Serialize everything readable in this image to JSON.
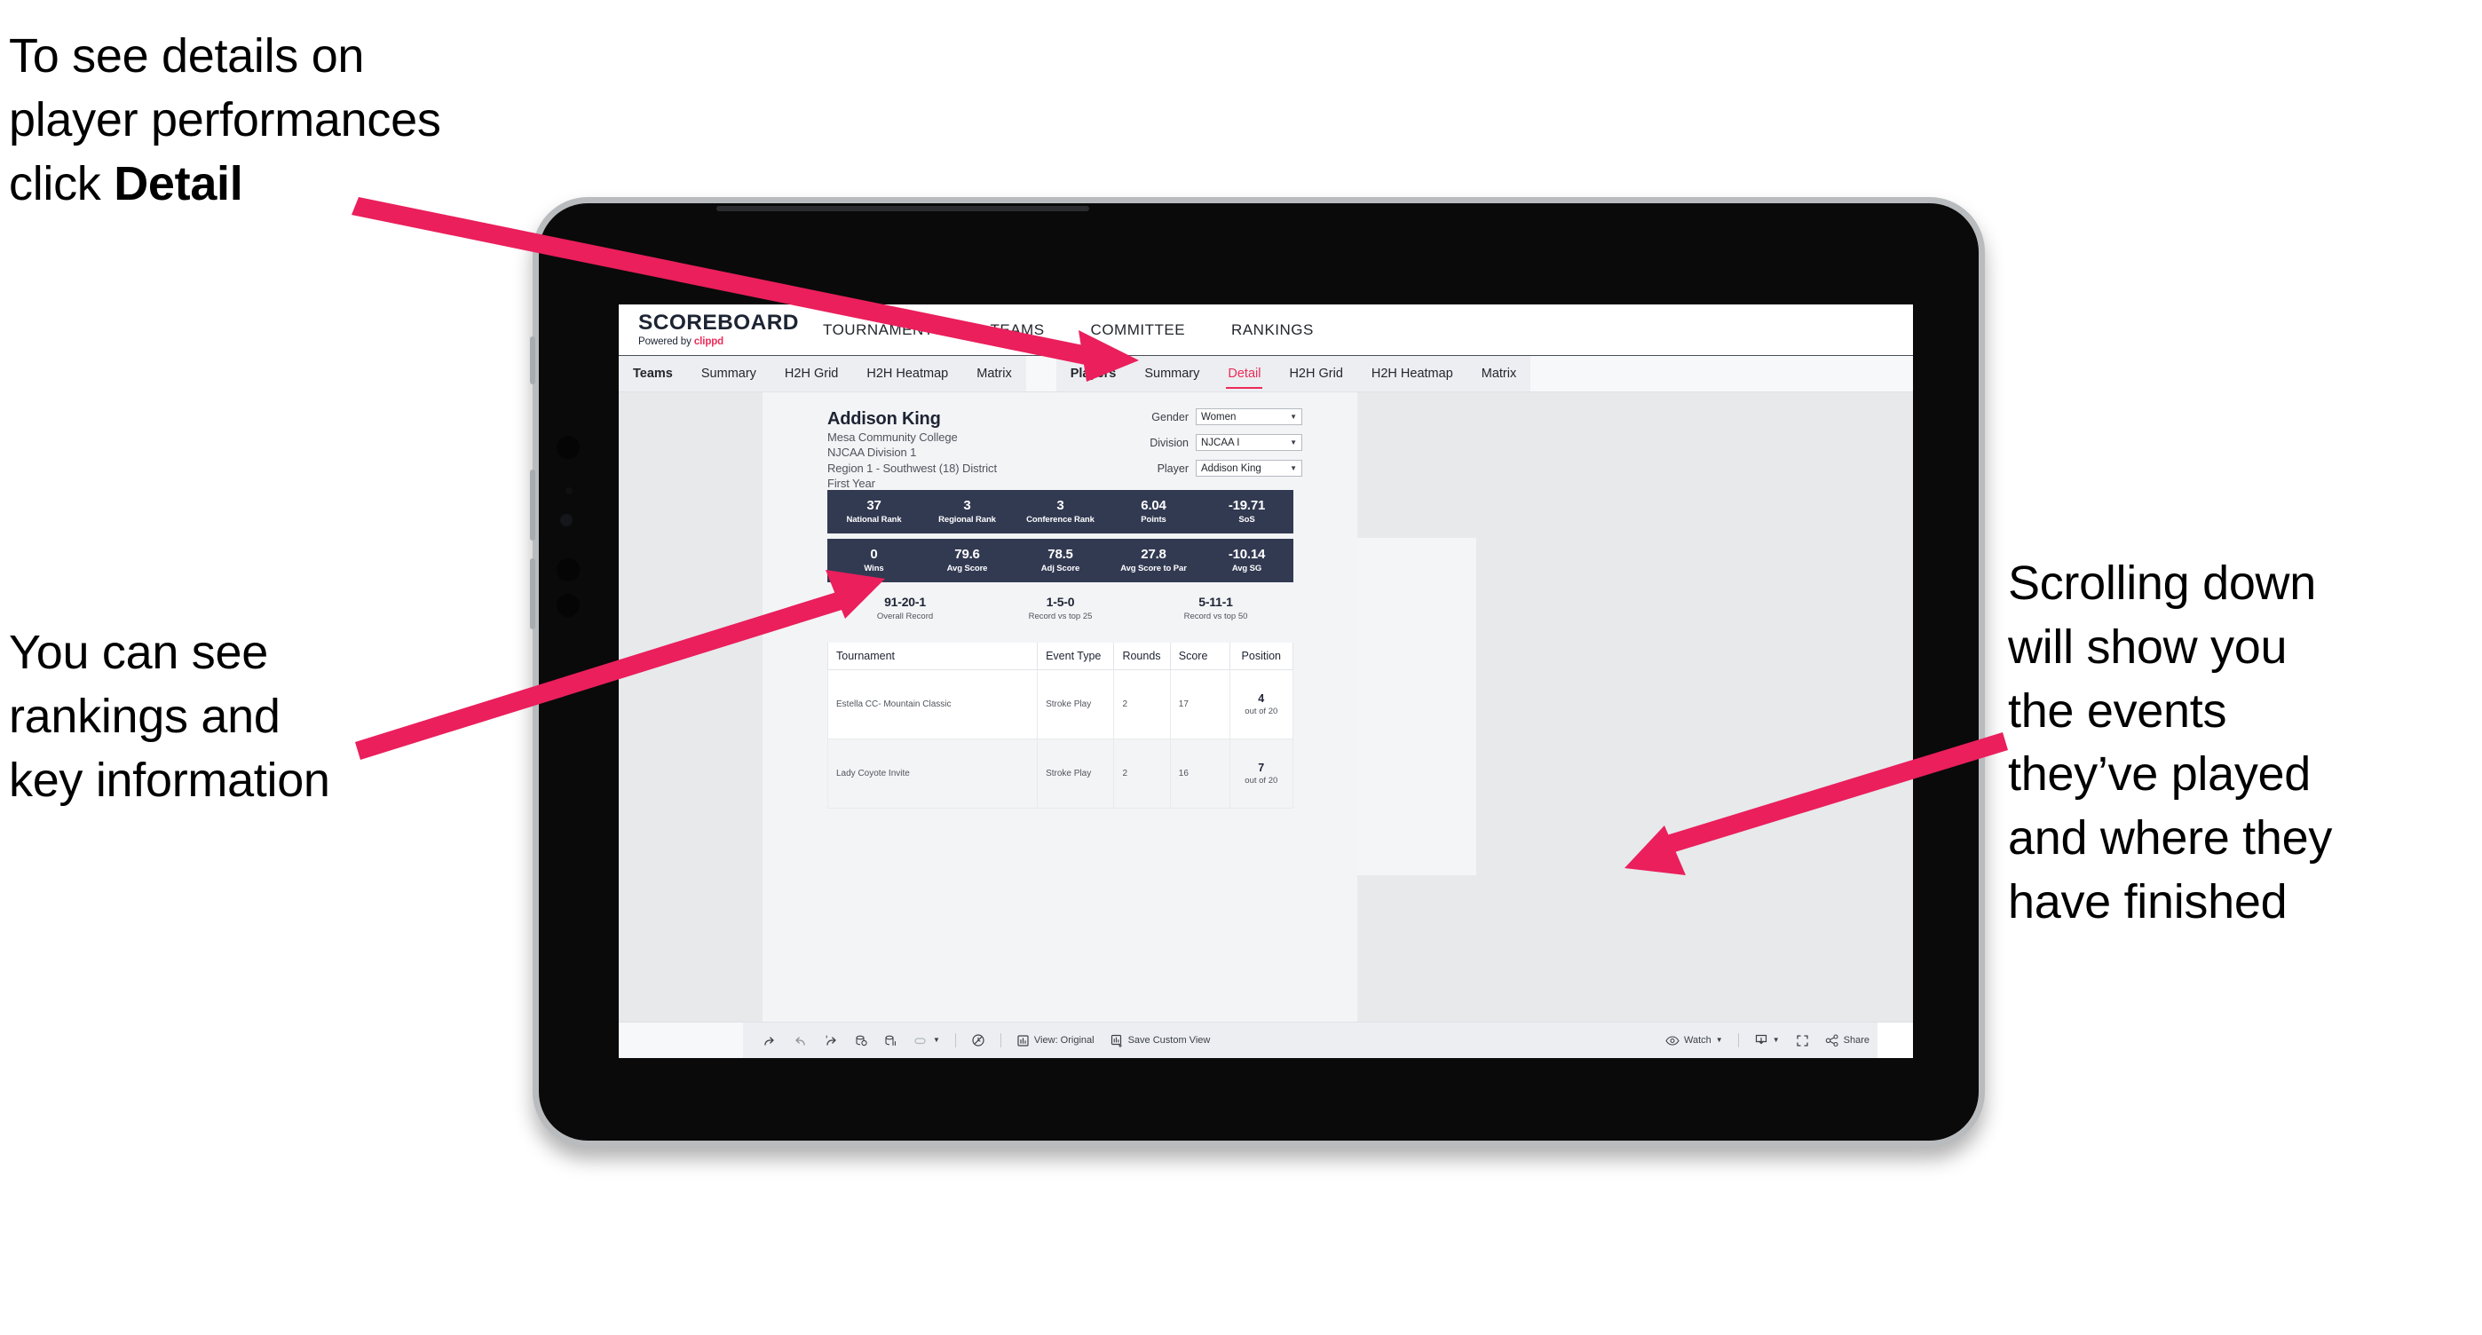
{
  "annotations": {
    "detail": "To see details on\nplayer performances\nclick ",
    "detail_bold": "Detail",
    "rankings": "You can see\nrankings and\nkey information",
    "scroll": "Scrolling down\nwill show you\nthe events\nthey’ve played\nand where they\nhave finished"
  },
  "colors": {
    "accent_pink": "#ec2b58",
    "navy": "#323a52",
    "arrow": "#ea1f5c"
  },
  "header": {
    "brand_title": "SCOREBOARD",
    "brand_sub_prefix": "Powered by ",
    "brand_sub_name": "clippd",
    "nav": [
      {
        "label": "TOURNAMENTS"
      },
      {
        "label": "TEAMS"
      },
      {
        "label": "COMMITTEE"
      },
      {
        "label": "RANKINGS"
      }
    ]
  },
  "subnav": {
    "group_teams": [
      {
        "label": "Teams",
        "lead": true,
        "active": false
      },
      {
        "label": "Summary",
        "lead": false,
        "active": false
      },
      {
        "label": "H2H Grid",
        "lead": false,
        "active": false
      },
      {
        "label": "H2H Heatmap",
        "lead": false,
        "active": false
      },
      {
        "label": "Matrix",
        "lead": false,
        "active": false
      }
    ],
    "group_players": [
      {
        "label": "Players",
        "lead": true,
        "active": false
      },
      {
        "label": "Summary",
        "lead": false,
        "active": false
      },
      {
        "label": "Detail",
        "lead": false,
        "active": true
      },
      {
        "label": "H2H Grid",
        "lead": false,
        "active": false
      },
      {
        "label": "H2H Heatmap",
        "lead": false,
        "active": false
      },
      {
        "label": "Matrix",
        "lead": false,
        "active": false
      }
    ]
  },
  "player": {
    "name": "Addison King",
    "school": "Mesa Community College",
    "division": "NJCAA Division 1",
    "region": "Region 1 - Southwest (18) District",
    "year": "First Year"
  },
  "filters": [
    {
      "label": "Gender",
      "value": "Women"
    },
    {
      "label": "Division",
      "value": "NJCAA I"
    },
    {
      "label": "Player",
      "value": "Addison King"
    }
  ],
  "stats_row_1": [
    {
      "value": "37",
      "label": "National Rank"
    },
    {
      "value": "3",
      "label": "Regional Rank"
    },
    {
      "value": "3",
      "label": "Conference Rank"
    },
    {
      "value": "6.04",
      "label": "Points"
    },
    {
      "value": "-19.71",
      "label": "SoS"
    }
  ],
  "stats_row_2": [
    {
      "value": "0",
      "label": "Wins"
    },
    {
      "value": "79.6",
      "label": "Avg Score"
    },
    {
      "value": "78.5",
      "label": "Adj Score"
    },
    {
      "value": "27.8",
      "label": "Avg Score to Par"
    },
    {
      "value": "-10.14",
      "label": "Avg SG"
    }
  ],
  "records": [
    {
      "value": "91-20-1",
      "label": "Overall Record"
    },
    {
      "value": "1-5-0",
      "label": "Record vs top 25"
    },
    {
      "value": "5-11-1",
      "label": "Record vs top 50"
    }
  ],
  "events_table": {
    "columns": [
      "Tournament",
      "Event Type",
      "Rounds",
      "Score",
      "Position"
    ],
    "rows": [
      {
        "tournament": "Estella CC- Mountain Classic",
        "event_type": "Stroke Play",
        "rounds": "2",
        "score": "17",
        "position_num": "4",
        "position_of": "out of 20"
      },
      {
        "tournament": "Lady Coyote Invite",
        "event_type": "Stroke Play",
        "rounds": "2",
        "score": "16",
        "position_num": "7",
        "position_of": "out of 20"
      }
    ]
  },
  "toolbar": {
    "view_label": "View: Original",
    "save_label": "Save Custom View",
    "watch_label": "Watch",
    "share_label": "Share"
  }
}
